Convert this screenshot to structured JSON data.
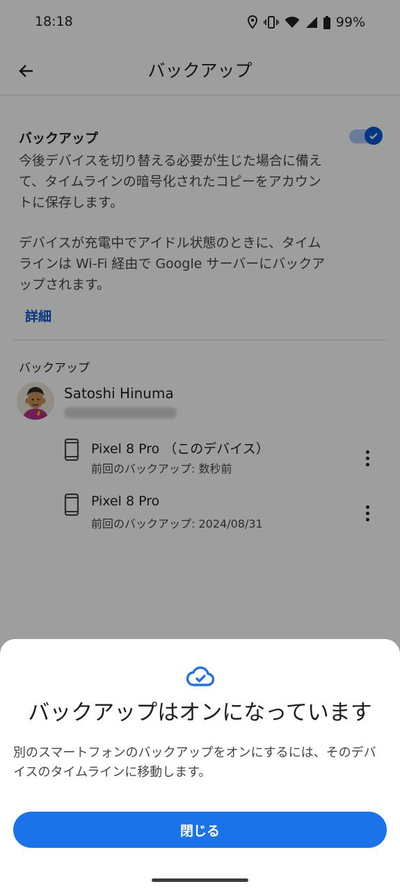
{
  "status_bar": {
    "time": "18:18",
    "battery": "99%",
    "icons": [
      "location-icon",
      "vibrate-icon",
      "wifi-icon",
      "signal-icon",
      "battery-icon"
    ]
  },
  "app_bar": {
    "back_icon": "arrow-back-icon",
    "title": "バックアップ"
  },
  "backup_setting": {
    "title": "バックアップ",
    "toggle_on": true,
    "description1": "今後デバイスを切り替える必要が生じた場合に備えて、タイムラインの暗号化されたコピーをアカウントに保存します。",
    "description2": "デバイスが充電中でアイドル状態のときに、タイムラインは Wi-Fi 経由で Google サーバーにバックアップされます。",
    "details_link": "詳細"
  },
  "backups_section": {
    "label": "バックアップ",
    "account_name": "Satoshi Hinuma",
    "devices": [
      {
        "name": "Pixel 8 Pro （このデバイス）",
        "last_backup": "前回のバックアップ: 数秒前",
        "icon": "phone-icon"
      },
      {
        "name": "Pixel 8 Pro",
        "last_backup": "前回のバックアップ: 2024/08/31",
        "icon": "phone-icon"
      }
    ]
  },
  "bottom_sheet": {
    "icon": "cloud-check-icon",
    "title": "バックアップはオンになっています",
    "body": "別のスマートフォンのバックアップをオンにするには、そのデバイスのタイムラインに移動します。",
    "close_label": "閉じる"
  },
  "colors": {
    "accent": "#1a73e8",
    "toggle_thumb": "#0b57d0",
    "toggle_track": "#a8c7fa",
    "scrim": "rgba(0,0,0,0.38)"
  }
}
